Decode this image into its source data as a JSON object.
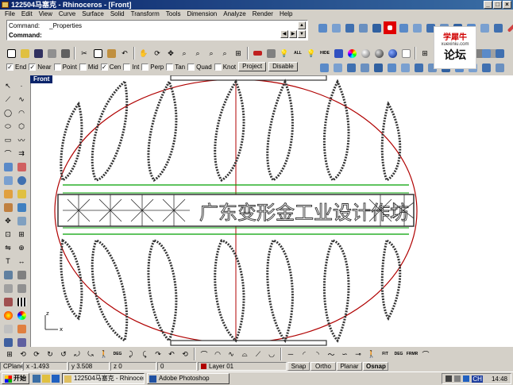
{
  "window": {
    "title": "122504马塞克 - Rhinoceros - [Front]",
    "minimize": "_",
    "maximize": "□",
    "close": "×"
  },
  "menu": [
    "File",
    "Edit",
    "View",
    "Curve",
    "Surface",
    "Solid",
    "Transform",
    "Tools",
    "Dimension",
    "Analyze",
    "Render",
    "Help"
  ],
  "command": {
    "history_label": "Command:",
    "history_value": "_Properties",
    "prompt_label": "Command:",
    "prompt_value": ""
  },
  "osnap": {
    "items": [
      {
        "label": "End",
        "checked": true
      },
      {
        "label": "Near",
        "checked": true
      },
      {
        "label": "Point",
        "checked": false
      },
      {
        "label": "Mid",
        "checked": false
      },
      {
        "label": "Cen",
        "checked": true
      },
      {
        "label": "Int",
        "checked": false
      },
      {
        "label": "Perp",
        "checked": false
      },
      {
        "label": "Tan",
        "checked": false
      },
      {
        "label": "Quad",
        "checked": false
      },
      {
        "label": "Knot",
        "checked": false
      }
    ],
    "project_label": "Project",
    "disable_label": "Disable"
  },
  "toolbar_text": {
    "all": "ALL",
    "hide": "HIDE",
    "deg": "DEG",
    "fit": "FIT",
    "frmr": "FRMR"
  },
  "viewport": {
    "label": "Front",
    "axis_z": "z",
    "axis_x": "x",
    "band_text": "广东变形金工业设计作坊"
  },
  "status": {
    "cplane": "CPlane",
    "x": "x -1.493",
    "y": "y 3.508",
    "z": "z 0",
    "zero": "0",
    "layer": "Layer 01",
    "snap": "Snap",
    "ortho": "Ortho",
    "planar": "Planar",
    "osnap": "Osnap"
  },
  "taskbar": {
    "start": "开始",
    "tasks": [
      "122504马塞克 - Rhinocer...",
      "Adobe Photoshop"
    ],
    "lang": "CH",
    "clock": "14:48"
  },
  "watermark": {
    "line1": "学犀牛",
    "line2": "xuexiniu.com",
    "line3": "论坛"
  },
  "colors": {
    "titlebar": "#0a246a",
    "chrome": "#d4d0c8",
    "outline_red": "#b00000",
    "band_green": "#00a000"
  }
}
